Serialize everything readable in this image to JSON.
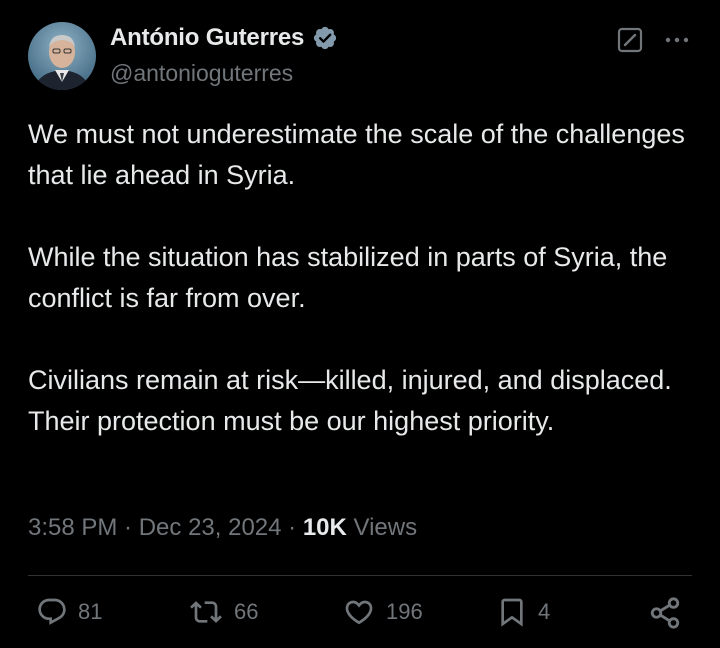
{
  "author": {
    "display_name": "António Guterres",
    "handle": "@antonioguterres",
    "verified": true,
    "verified_color": "#71767b"
  },
  "post": {
    "paragraphs": [
      "We must not underestimate the scale of the challenges that lie ahead in Syria.",
      "While the situation has stabilized in parts of Syria, the conflict is far from over.",
      "Civilians remain at risk—killed, injured, and displaced. Their protection must be our highest priority."
    ],
    "time": "3:58 PM",
    "separator": " · ",
    "date": "Dec 23, 2024",
    "views_count": "10K",
    "views_label": " Views"
  },
  "actions": {
    "replies": "81",
    "reposts": "66",
    "likes": "196",
    "bookmarks": "4"
  },
  "icons": {
    "edit": "edit-icon",
    "more": "more-icon",
    "reply": "reply-icon",
    "repost": "repost-icon",
    "like": "heart-icon",
    "bookmark": "bookmark-icon",
    "share": "share-icon"
  },
  "colors": {
    "background": "#000000",
    "text": "#e7e9ea",
    "secondary": "#71767b",
    "divider": "#2f3336"
  }
}
